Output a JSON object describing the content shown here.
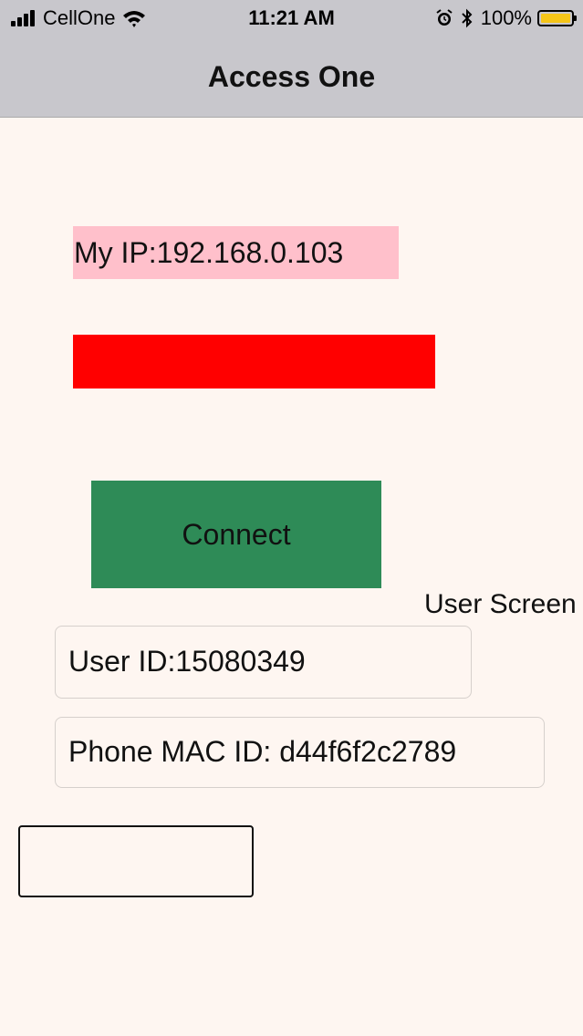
{
  "status_bar": {
    "carrier": "CellOne",
    "time": "11:21 AM",
    "battery_percent": "100%",
    "battery_level": 1.0,
    "icons": [
      "signal-icon",
      "wifi-icon",
      "alarm-icon",
      "bluetooth-icon",
      "battery-icon"
    ]
  },
  "nav": {
    "title": "Access One"
  },
  "main": {
    "ip_text": "My IP:192.168.0.103",
    "connect_label": "Connect",
    "user_screen_label": "User Screen",
    "user_id_text": "User ID:15080349",
    "mac_id_text": "Phone MAC ID: d44f6f2c2789"
  },
  "colors": {
    "background": "#fef6f1",
    "bar": "#c8c7cc",
    "ip_bg": "#ffc0cb",
    "status_red": "#ff0000",
    "connect_green": "#2e8b57",
    "battery_yellow": "#f5c518"
  }
}
